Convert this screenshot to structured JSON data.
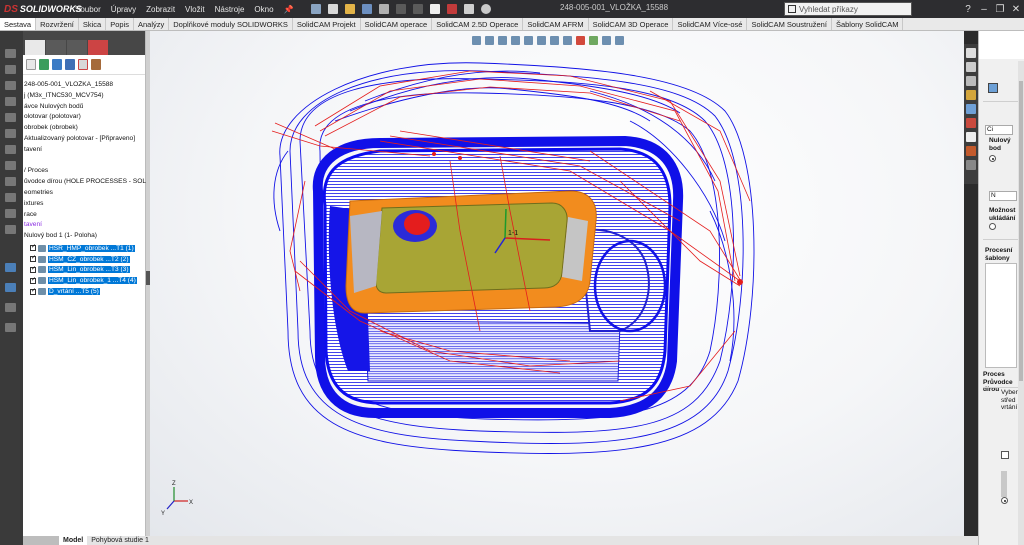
{
  "app": {
    "logo_ds": "DS",
    "logo_text": "SOLIDWORKS"
  },
  "menu": [
    "Soubor",
    "Úpravy",
    "Zobrazit",
    "Vložit",
    "Nástroje",
    "Okno"
  ],
  "document_title": "248-005-001_VLOŽKA_15588",
  "search": {
    "placeholder": "Vyhledat příkazy"
  },
  "window_controls": [
    "?",
    "–",
    "❐",
    "✕"
  ],
  "tabs": [
    "Sestava",
    "Rozvržení",
    "Skica",
    "Popis",
    "Analýzy",
    "Doplňkové moduly SOLIDWORKS",
    "SolidCAM Projekt",
    "SolidCAM operace",
    "SolidCAM 2.5D Operace",
    "SolidCAM AFRM",
    "SolidCAM 3D Operace",
    "SolidCAM Více-osé",
    "SolidCAM Soustružení",
    "Šablony SolidCAM"
  ],
  "tree": {
    "nodes": [
      {
        "text": "248-005-001_VLOŽKA_15588",
        "style": "normal"
      },
      {
        "text": "j (M3x_ITNC530_MCV754)",
        "style": "normal"
      },
      {
        "text": "ávce Nulových bodů",
        "style": "normal"
      },
      {
        "text": "olotovar (polotovar)",
        "style": "normal"
      },
      {
        "text": "obrobek (obrobek)",
        "style": "normal"
      },
      {
        "text": "Aktualizovaný polotovar - [Připraveno]",
        "style": "normal"
      },
      {
        "text": "tavení",
        "style": "normal"
      },
      {
        "text": "",
        "style": "normal"
      },
      {
        "text": "/ Proces",
        "style": "normal"
      },
      {
        "text": "ůvodce dírou (HOLE PROCESSES - SOLIDWORKS",
        "style": "normal"
      },
      {
        "text": "eometries",
        "style": "normal"
      },
      {
        "text": "ixtures",
        "style": "normal"
      },
      {
        "text": "race",
        "style": "normal"
      },
      {
        "text": "tavení",
        "style": "purple"
      },
      {
        "text": " Nulový bod 1 (1- Poloha)",
        "style": "normal"
      }
    ],
    "operations": [
      {
        "label": "HSR_HMP_obrobek ...T1 (1)"
      },
      {
        "label": "HSM_CZ_obrobek ...T2 (2)"
      },
      {
        "label": "HSM_Lin_obrobek ...T3 (3)"
      },
      {
        "label": "HSM_Lin_obrobek_1 ...T4 (4)"
      },
      {
        "label": "D_vrtání ...T5 (5)"
      }
    ]
  },
  "bottom_tabs": [
    "Model",
    "Pohybová studie 1"
  ],
  "triad": {
    "x": "X",
    "y": "Y",
    "z": "Z"
  },
  "origin_label": "1-1",
  "right_panel": {
    "items": [
      {
        "text": "Nulový bod",
        "bold": true
      },
      {
        "text": "Možnost ukládání",
        "bold": true
      },
      {
        "text": "Procesní šablony",
        "bold": true
      },
      {
        "text": "Proces Průvodce dírou",
        "bold": true
      },
      {
        "text": "Vyber střed vrtání",
        "bold": false
      }
    ],
    "misc": [
      "Ci",
      "N"
    ]
  },
  "colors": {
    "toolpath_blue": "#1212e6",
    "toolpath_red": "#e41d1d",
    "part_orange": "#f28c1e",
    "part_olive": "#a8a535",
    "selection": "#0078d7"
  }
}
